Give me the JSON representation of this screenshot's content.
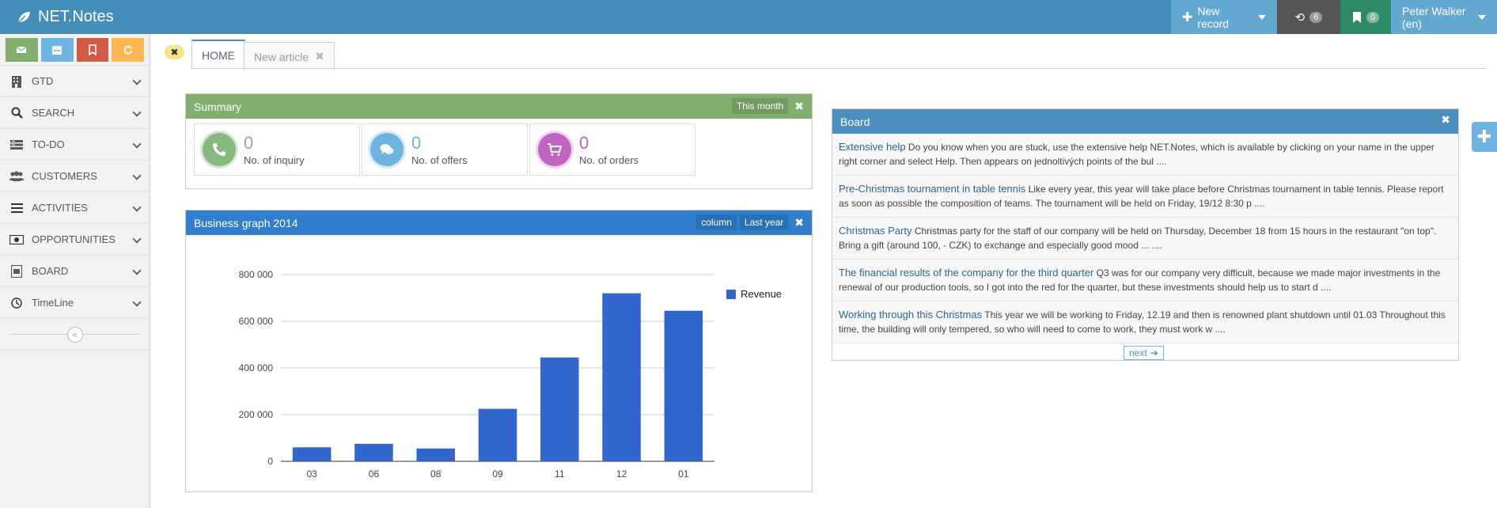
{
  "app": {
    "title": "NET.Notes"
  },
  "header": {
    "new_record": "New record",
    "history_count": "6",
    "bookmarks_count": "0",
    "user": "Peter Walker (en)"
  },
  "sidebar": {
    "items": [
      {
        "label": "GTD",
        "icon": "building-icon"
      },
      {
        "label": "SEARCH",
        "icon": "search-icon"
      },
      {
        "label": "TO-DO",
        "icon": "list-icon"
      },
      {
        "label": "CUSTOMERS",
        "icon": "users-icon"
      },
      {
        "label": "ACTIVITIES",
        "icon": "bars-icon"
      },
      {
        "label": "OPPORTUNITIES",
        "icon": "money-icon"
      },
      {
        "label": "BOARD",
        "icon": "board-icon"
      },
      {
        "label": "TimeLine",
        "icon": "clock-icon"
      }
    ],
    "colors": {
      "green": "#82af6f",
      "blue": "#6fb3e0",
      "red": "#d15b47",
      "orange": "#ffb752"
    }
  },
  "tabs": [
    {
      "label": "HOME"
    },
    {
      "label": "New article"
    }
  ],
  "summary": {
    "title": "Summary",
    "filter": "This month",
    "stats": [
      {
        "value": "0",
        "label": "No. of inquiry",
        "color": "#87b87f"
      },
      {
        "value": "0",
        "label": "No. of offers",
        "color": "#6fb3e0"
      },
      {
        "value": "0",
        "label": "No. of orders",
        "color": "#c163c1"
      }
    ]
  },
  "graph": {
    "title": "Business graph 2014",
    "type_button": "column",
    "period_button": "Last year"
  },
  "chart_data": {
    "type": "bar",
    "categories": [
      "03",
      "06",
      "08",
      "09",
      "11",
      "12",
      "01"
    ],
    "series": [
      {
        "name": "Revenue",
        "values": [
          60000,
          75000,
          55000,
          225000,
          445000,
          720000,
          645000
        ],
        "color": "#3366cc"
      }
    ],
    "ylim": [
      0,
      800000
    ],
    "yticks": [
      "0",
      "200 000",
      "400 000",
      "600 000",
      "800 000"
    ],
    "grid": true,
    "legend": "right"
  },
  "board": {
    "title": "Board",
    "items": [
      {
        "title": "Extensive help",
        "text": "Do you know when you are stuck, use the extensive help NET.Notes, which is available by clicking on your name in the upper right corner and select Help. Then appears on jednoltivých points of the bul ...."
      },
      {
        "title": "Pre-Christmas tournament in table tennis",
        "text": "Like every year, this year will take place before Christmas tournament in table tennis. Please report as soon as possible the composition of teams. The tournament will be held on Friday, 19/12 8:30 p ...."
      },
      {
        "title": "Christmas Party",
        "text": "Christmas party for the staff of our company will be held on Thursday, December 18 from 15 hours in the restaurant \"on top\". Bring a gift (around 100, - CZK) to exchange and especially good mood ... ...."
      },
      {
        "title": "The financial results of the company for the third quarter",
        "text": "Q3 was for our company very difficult, because we made major investments in the renewal of our production tools, so I got into the red for the quarter, but these investments should help us to start d ...."
      },
      {
        "title": "Working through this Christmas",
        "text": "This year we will be working to Friday, 12.19 and then is renowned plant shutdown until 01.03 Throughout this time, the building will only tempered, so who will need to come to work, they must work w ...."
      }
    ],
    "next": "next"
  }
}
